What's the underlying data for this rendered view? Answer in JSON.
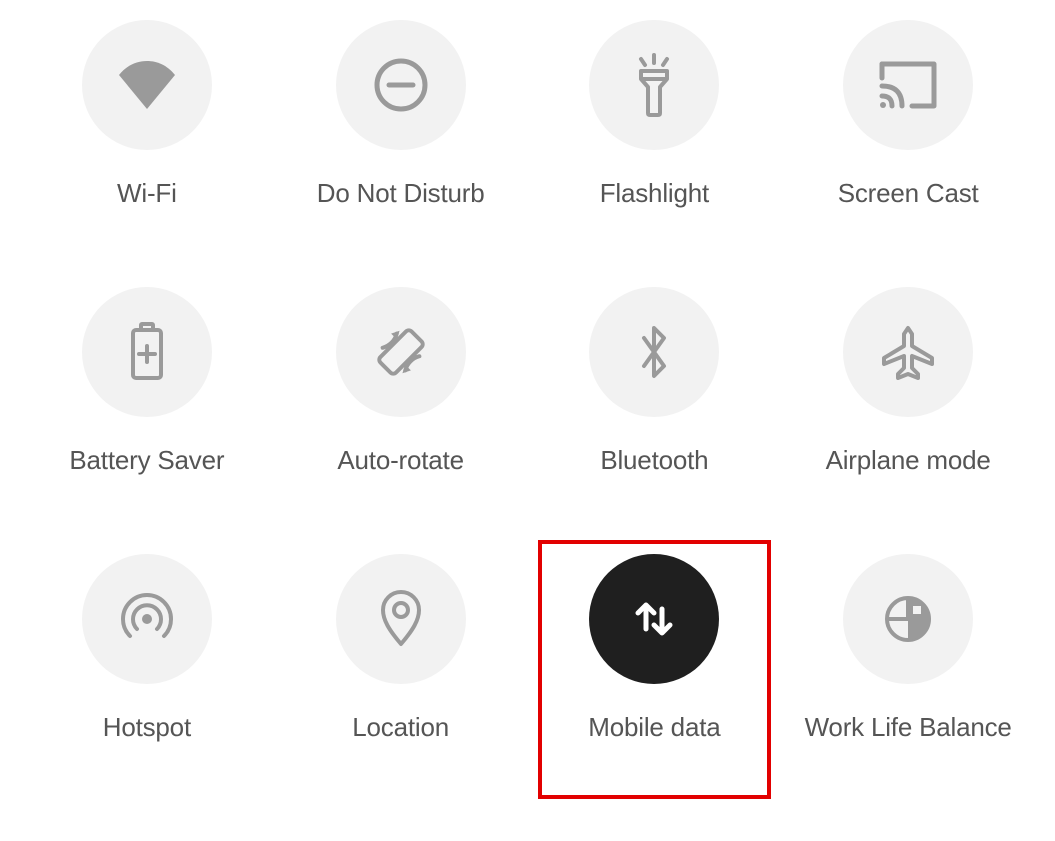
{
  "tiles": [
    {
      "id": "wifi",
      "label": "Wi-Fi",
      "icon": "wifi-icon",
      "active": false,
      "highlighted": false
    },
    {
      "id": "dnd",
      "label": "Do Not Disturb",
      "icon": "dnd-icon",
      "active": false,
      "highlighted": false
    },
    {
      "id": "flashlight",
      "label": "Flashlight",
      "icon": "flashlight-icon",
      "active": false,
      "highlighted": false
    },
    {
      "id": "screen-cast",
      "label": "Screen Cast",
      "icon": "cast-icon",
      "active": false,
      "highlighted": false
    },
    {
      "id": "battery-saver",
      "label": "Battery Saver",
      "icon": "battery-icon",
      "active": false,
      "highlighted": false
    },
    {
      "id": "auto-rotate",
      "label": "Auto-rotate",
      "icon": "rotate-icon",
      "active": false,
      "highlighted": false
    },
    {
      "id": "bluetooth",
      "label": "Bluetooth",
      "icon": "bluetooth-icon",
      "active": false,
      "highlighted": false
    },
    {
      "id": "airplane",
      "label": "Airplane mode",
      "icon": "airplane-icon",
      "active": false,
      "highlighted": false
    },
    {
      "id": "hotspot",
      "label": "Hotspot",
      "icon": "hotspot-icon",
      "active": false,
      "highlighted": false
    },
    {
      "id": "location",
      "label": "Location",
      "icon": "location-icon",
      "active": false,
      "highlighted": false
    },
    {
      "id": "mobile-data",
      "label": "Mobile data",
      "icon": "data-icon",
      "active": true,
      "highlighted": true
    },
    {
      "id": "work-life",
      "label": "Work Life Balance",
      "icon": "worklife-icon",
      "active": false,
      "highlighted": false
    }
  ],
  "colors": {
    "inactive_bg": "#f2f2f2",
    "active_bg": "#1f1f1f",
    "icon_inactive": "#9a9a9a",
    "icon_active": "#ffffff",
    "highlight": "#e20000",
    "label": "#555555"
  }
}
